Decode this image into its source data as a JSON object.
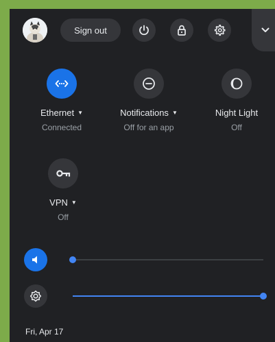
{
  "topbar": {
    "avatar_icon": "user-avatar-cat",
    "sign_out_label": "Sign out",
    "power_icon": "power-icon",
    "lock_icon": "lock-icon",
    "settings_icon": "gear-icon",
    "expand_icon": "chevron-down-icon"
  },
  "tiles": [
    {
      "label": "Ethernet",
      "status": "Connected",
      "icon": "ethernet-icon",
      "active": true,
      "has_menu": true
    },
    {
      "label": "Notifications",
      "status": "Off for an app",
      "icon": "do-not-disturb-icon",
      "active": false,
      "has_menu": true
    },
    {
      "label": "Night Light",
      "status": "Off",
      "icon": "night-light-icon",
      "active": false,
      "has_menu": false
    },
    {
      "label": "VPN",
      "status": "Off",
      "icon": "vpn-key-icon",
      "active": false,
      "has_menu": true
    }
  ],
  "sliders": {
    "volume": {
      "icon": "volume-icon",
      "level": 0.0
    },
    "brightness": {
      "icon": "brightness-icon",
      "level": 1.0
    }
  },
  "footer": {
    "date": "Fri, Apr 17"
  },
  "colors": {
    "accent": "#1a73e8",
    "panel_bg": "#202124",
    "button_bg": "#35363a",
    "border": "#7dab4a"
  }
}
